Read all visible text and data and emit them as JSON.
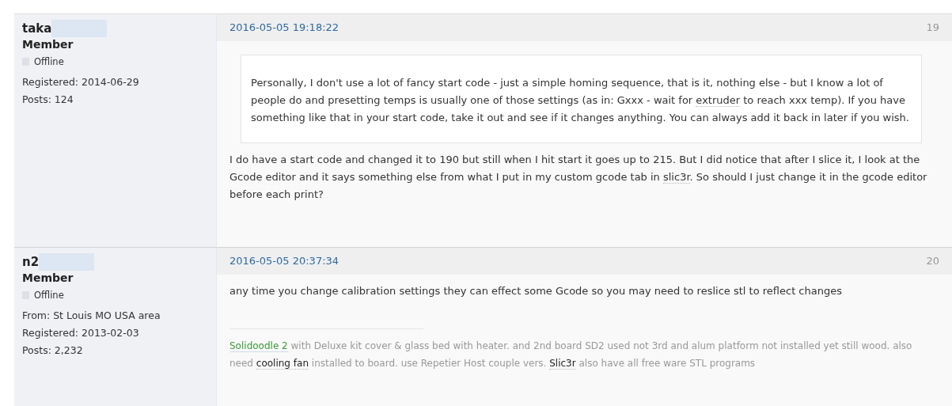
{
  "posts": [
    {
      "author": {
        "name": "taka",
        "title": "Member",
        "status": "Offline",
        "online": false,
        "details": [
          "Registered: 2014-06-29",
          "Posts: 124"
        ]
      },
      "date": "2016-05-05 19:18:22",
      "number": "19",
      "quote": [
        {
          "kind": "text",
          "text": "Personally, I don't use a lot of fancy start code - just a simple homing sequence, that is it, nothing else - but I know a lot of people do and presetting temps is usually one of those settings (as in: Gxxx - wait for "
        },
        {
          "kind": "link",
          "text": "extruder"
        },
        {
          "kind": "text",
          "text": " to reach xxx temp). If you have something like that in your start code, take it out and see if it changes anything. You can always add it back in later if you wish."
        }
      ],
      "body": [
        {
          "kind": "text",
          "text": "I do have a start code and changed it to 190 but still when I hit start it goes up to 215. But I did notice that after I slice it, I look at the Gcode editor and it says something else from what I put in my custom gcode tab in "
        },
        {
          "kind": "link",
          "text": "slic3r"
        },
        {
          "kind": "text",
          "text": ". So should I just change it in the gcode editor before each print?"
        }
      ]
    },
    {
      "author": {
        "name": "n2",
        "title": "Member",
        "status": "Offline",
        "online": false,
        "details": [
          "From: St Louis MO USA area",
          "Registered: 2013-02-03",
          "Posts: 2,232"
        ]
      },
      "date": "2016-05-05 20:37:34",
      "number": "20",
      "body": [
        {
          "kind": "text",
          "text": "any time you change calibration settings they can effect some Gcode so you may need to reslice stl to reflect changes"
        }
      ],
      "signature": [
        {
          "kind": "highlight",
          "text": "Solidoodle 2"
        },
        {
          "kind": "text",
          "text": " with Deluxe kit cover & glass bed with heater. and 2nd board SD2 used not 3rd and alum platform not installed yet still wood. also need "
        },
        {
          "kind": "link",
          "text": "cooling fan"
        },
        {
          "kind": "text",
          "text": " installed to board. use Repetier Host couple vers. "
        },
        {
          "kind": "link",
          "text": "Slic3r"
        },
        {
          "kind": "text",
          "text": " also have all free ware STL programs"
        }
      ]
    }
  ]
}
